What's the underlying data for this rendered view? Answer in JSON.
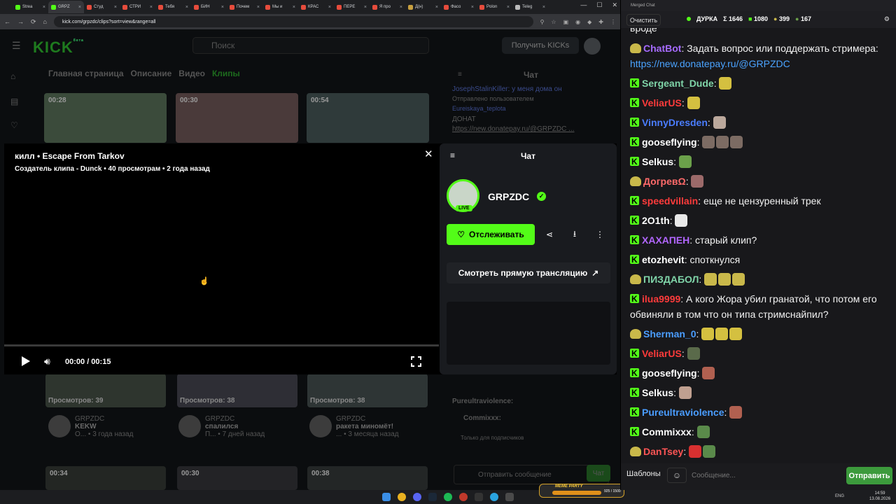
{
  "browser": {
    "tabs": [
      {
        "label": "Strea",
        "color": "#53fc18"
      },
      {
        "label": "GRPZ",
        "color": "#53fc18",
        "active": true
      },
      {
        "label": "Студ",
        "color": "#e74c3c"
      },
      {
        "label": "СТРИ",
        "color": "#e74c3c"
      },
      {
        "label": "Тебя",
        "color": "#e74c3c"
      },
      {
        "label": "БИН",
        "color": "#e74c3c"
      },
      {
        "label": "Почем",
        "color": "#e74c3c"
      },
      {
        "label": "Мы и",
        "color": "#e74c3c"
      },
      {
        "label": "КРАС",
        "color": "#e74c3c"
      },
      {
        "label": "ПЕРЕ",
        "color": "#e74c3c"
      },
      {
        "label": "Я про",
        "color": "#e74c3c"
      },
      {
        "label": "Д(н)",
        "color": "#c8a040"
      },
      {
        "label": "Фасо",
        "color": "#e74c3c"
      },
      {
        "label": "Polon",
        "color": "#e74c3c"
      },
      {
        "label": "Teleg",
        "color": "#bbbbbb"
      }
    ],
    "url": "kick.com/grpzdc/clips?sort=view&range=all"
  },
  "kick": {
    "logo": "KICK",
    "logo_sup": "бета",
    "search_placeholder": "Поиск",
    "get_kicks": "Получить KICKs",
    "nav": [
      "Главная страница",
      "Описание",
      "Видео",
      "Клипы"
    ],
    "top_durations": [
      "00:28",
      "00:30",
      "00:54"
    ],
    "bottom_clips": [
      {
        "views": "Просмотров: 39",
        "channel": "GRPZDC",
        "title": "KEKW",
        "ago": "3 года назад",
        "who": "O..."
      },
      {
        "views": "Просмотров: 38",
        "channel": "GRPZDC",
        "title": "спалился",
        "ago": "7 дней назад",
        "who": "П..."
      },
      {
        "views": "Просмотров: 38",
        "channel": "GRPZDC",
        "title": "ракета миномёт!",
        "ago": "3 месяца назад",
        "who": "..."
      }
    ],
    "bottom_durations": [
      "00:34",
      "00:30",
      "00:38"
    ],
    "bg_chat": {
      "title": "Чат",
      "pinned_label": "Отправлено пользователем",
      "pinned_user": "Eureiskaya_teplota",
      "pinned_text": "ДОНАТ",
      "pinned_link": "https://new.donatepay.ru/@GRPZDC ...",
      "top_user": "JosephStalinKiller",
      "top_text": "у меня дома он",
      "users": [
        "Pureultraviolence:",
        "Commixxx:"
      ],
      "subs_only": "Только для подписчиков",
      "send_placeholder": "Отправить сообщение",
      "chat_button": "Чат"
    }
  },
  "modal": {
    "title": "килл • Escape From Tarkov",
    "meta": "Создатель клипа - Dunck • 40 просмотрам • 2 года назад",
    "time": "00:00 / 00:15",
    "side": {
      "title": "Чат",
      "channel": "GRPZDC",
      "live": "LIVE",
      "follow": "Отслеживать",
      "watch_live": "Смотреть прямую трансляцию"
    }
  },
  "taskbar": {
    "meme_label": "MEME PARTY",
    "meme_count": "925 / 1500",
    "lang": "ENG",
    "time": "14:59",
    "date": "13.08.2026"
  },
  "merged_chat": {
    "window_title": "Merged Chat",
    "clear": "Очистить",
    "channel": "ДУРКА",
    "stats": {
      "total": "Σ 1646",
      "kick": "1080",
      "peep": "399",
      "frog": "167"
    },
    "partial_top": "вроде",
    "messages": [
      {
        "badge": "peep",
        "user": "ChatBot",
        "color": "#a66bff",
        "text": "Задать вопрос или поддержать стримера: ",
        "link": "https://new.donatepay.ru/@GRPZDC",
        "emotes": []
      },
      {
        "badge": "kick",
        "user": "Sergeant_Dude",
        "color": "#7fd4a8",
        "text": "",
        "emotes": [
          "#d4c040"
        ]
      },
      {
        "badge": "kick",
        "user": "VeliarUS",
        "color": "#ff3b3b",
        "text": "",
        "emotes": [
          "#d4c040"
        ]
      },
      {
        "badge": "kick",
        "user": "VinnyDresden",
        "color": "#4a7dff",
        "text": "",
        "emotes": [
          "#bba89c"
        ]
      },
      {
        "badge": "kick",
        "user": "goosefIying",
        "color": "#ffffff",
        "text": "",
        "emotes": [
          "#7c6b63",
          "#7c6b63",
          "#7c6b63"
        ]
      },
      {
        "badge": "kick",
        "user": "Selkus",
        "color": "#ffffff",
        "text": "",
        "emotes": [
          "#6ba04a"
        ]
      },
      {
        "badge": "peep",
        "user": "ДогревΩ",
        "color": "#ff6a6a",
        "text": "",
        "emotes": [
          "#9c6a6a"
        ]
      },
      {
        "badge": "kick",
        "user": "speedvillain",
        "color": "#ff3b3b",
        "text": "еще не цензуренный трек",
        "emotes": []
      },
      {
        "badge": "kick",
        "user": "2O1th",
        "color": "#ffffff",
        "text": "",
        "emotes": [
          "#e8e8e8"
        ]
      },
      {
        "badge": "kick",
        "user": "ХАХАПЕН",
        "color": "#b266ff",
        "text": "старый клип?",
        "emotes": []
      },
      {
        "badge": "kick",
        "user": "etozhevit",
        "color": "#ffffff",
        "text": "споткнулся",
        "emotes": []
      },
      {
        "badge": "peep",
        "user": "ПИЗДАБОЛ",
        "color": "#7fd4a8",
        "text": "",
        "emotes": [
          "#c9b84a",
          "#c9b84a",
          "#c9b84a"
        ]
      },
      {
        "badge": "kick",
        "user": "ilua9999",
        "color": "#ff3b3b",
        "text": "А кого Жора убил гранатой, что потом его обвиняли в том что он типа стримснайпил?",
        "emotes": []
      },
      {
        "badge": "peep",
        "user": "Sherman_0",
        "color": "#4a9dff",
        "text": "",
        "emotes": [
          "#d4c040",
          "#d4c040",
          "#d4c040"
        ]
      },
      {
        "badge": "kick",
        "user": "VeliarUS",
        "color": "#ff3b3b",
        "text": "",
        "emotes": [
          "#5a6a4a"
        ]
      },
      {
        "badge": "kick",
        "user": "goosefIying",
        "color": "#ffffff",
        "text": "",
        "emotes": [
          "#b06050"
        ]
      },
      {
        "badge": "kick",
        "user": "Selkus",
        "color": "#ffffff",
        "text": "",
        "emotes": [
          "#c0a090"
        ]
      },
      {
        "badge": "kick",
        "user": "Pureultraviolence",
        "color": "#4a9dff",
        "text": "",
        "emotes": [
          "#b06050"
        ]
      },
      {
        "badge": "kick",
        "user": "Commixxx",
        "color": "#ffffff",
        "text": "",
        "emotes": [
          "#5a8a4a"
        ]
      },
      {
        "badge": "peep",
        "user": "DanTsey",
        "color": "#ff5555",
        "text": "",
        "emotes": [
          "#d83030",
          "#5a8a4a"
        ]
      }
    ],
    "templates": "Шаблоны",
    "input_placeholder": "Сообщение...",
    "send": "Отправить"
  }
}
